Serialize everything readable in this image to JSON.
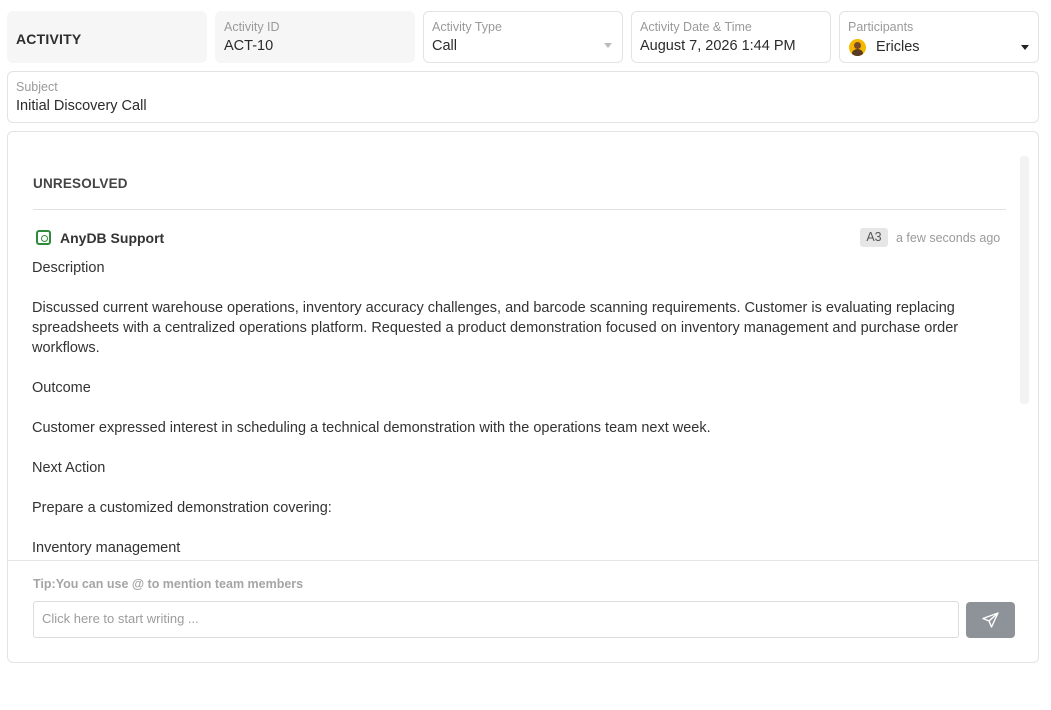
{
  "header": {
    "title": "ACTIVITY"
  },
  "fields": {
    "activity_id": {
      "label": "Activity ID",
      "value": "ACT-10"
    },
    "activity_type": {
      "label": "Activity Type",
      "value": "Call"
    },
    "activity_datetime": {
      "label": "Activity Date & Time",
      "value": "August 7, 2026 1:44 PM"
    },
    "participants": {
      "label": "Participants",
      "value": "Ericles",
      "avatar_color": "#f5b800"
    },
    "subject": {
      "label": "Subject",
      "value": "Initial Discovery Call"
    }
  },
  "thread": {
    "section_title": "UNRESOLVED",
    "comment": {
      "author": "AnyDB Support",
      "author_icon": "anydb-logo-icon",
      "badge": "A3",
      "timestamp": "a few seconds ago",
      "paragraphs": [
        "Description",
        "Discussed current warehouse operations, inventory accuracy challenges, and barcode scanning requirements. Customer is evaluating replacing spreadsheets with a centralized operations platform. Requested a product demonstration focused on inventory management and purchase order workflows.",
        "Outcome",
        "Customer expressed interest in scheduling a technical demonstration with the operations team next week.",
        "Next Action",
        "Prepare a customized demonstration covering:",
        "Inventory management"
      ]
    }
  },
  "composer": {
    "tip_label": "Tip:",
    "tip_text": "You can use @ to mention team members",
    "placeholder": "Click here to start writing ...",
    "send_icon": "send-icon",
    "send_color": "#8e939a"
  }
}
